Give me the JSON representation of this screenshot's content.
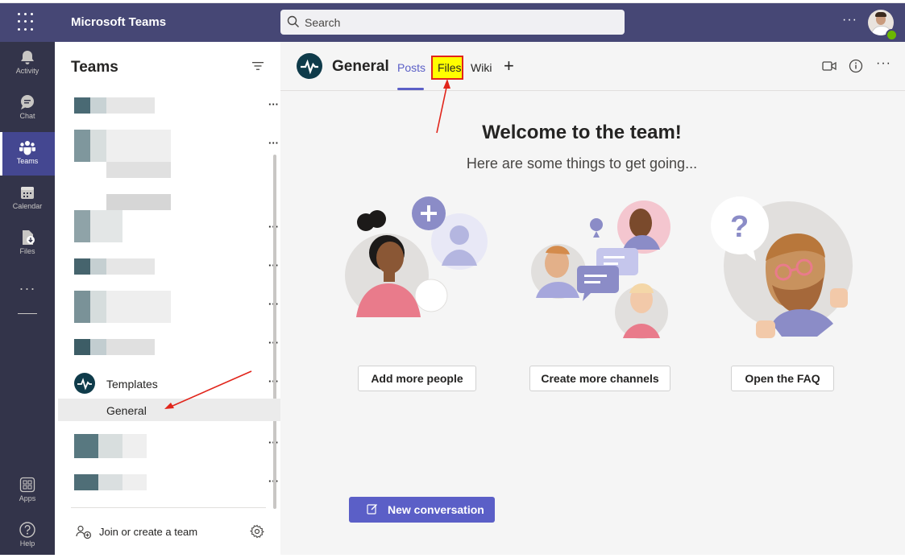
{
  "app": {
    "title": "Microsoft Teams"
  },
  "search": {
    "placeholder": "Search"
  },
  "topbar": {
    "more": "···"
  },
  "rail": {
    "items": [
      {
        "label": "Activity",
        "icon": "bell-icon"
      },
      {
        "label": "Chat",
        "icon": "chat-icon"
      },
      {
        "label": "Teams",
        "icon": "teams-icon"
      },
      {
        "label": "Calendar",
        "icon": "calendar-icon"
      },
      {
        "label": "Files",
        "icon": "files-icon"
      }
    ],
    "more": "···",
    "apps_label": "Apps",
    "help_label": "Help"
  },
  "panel": {
    "title": "Teams",
    "team_name": "Templates",
    "channel_name": "General",
    "join_label": "Join or create a team",
    "more": "···"
  },
  "channel": {
    "title": "General",
    "tabs": {
      "posts": "Posts",
      "files": "Files",
      "wiki": "Wiki",
      "add": "+"
    },
    "more": "···"
  },
  "welcome": {
    "heading": "Welcome to the team!",
    "subtitle": "Here are some things to get going...",
    "cards": [
      "Add more people",
      "Create more channels",
      "Open the FAQ"
    ]
  },
  "compose": {
    "new_conversation": "New conversation"
  },
  "colors": {
    "brand": "#464775",
    "accent": "#5b5fc7",
    "rail": "#33344a",
    "highlight": "#ffff00",
    "annotation": "#e1251b"
  }
}
